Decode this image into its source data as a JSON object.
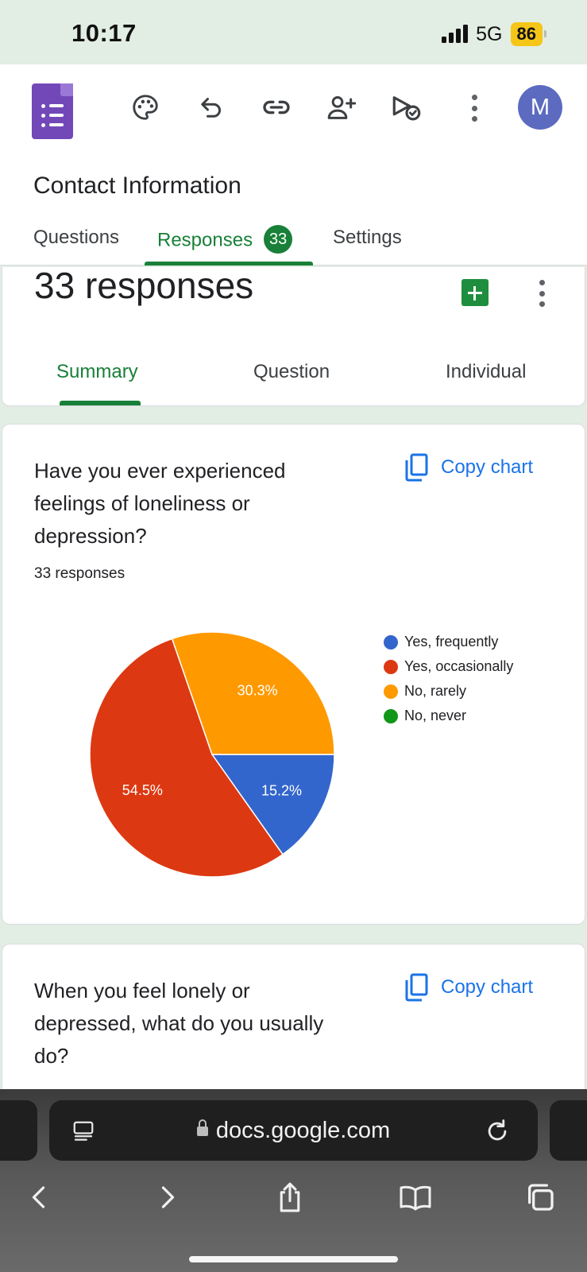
{
  "status_bar": {
    "time": "10:17",
    "network": "5G",
    "battery": "86"
  },
  "form": {
    "title": "Contact Information",
    "avatar_initial": "M",
    "tabs": {
      "questions": "Questions",
      "responses": "Responses",
      "responses_count": "33",
      "settings": "Settings"
    }
  },
  "summary": {
    "response_count": "33 responses",
    "sub_tabs": {
      "summary": "Summary",
      "question": "Question",
      "individual": "Individual"
    }
  },
  "questions": [
    {
      "title": "Have you ever experienced feelings of loneliness or depression?",
      "responses": "33 responses",
      "copy_label": "Copy chart"
    },
    {
      "title": "When you feel lonely or depressed, what do you usually do?",
      "copy_label": "Copy chart"
    }
  ],
  "chart_data": {
    "type": "pie",
    "title": "Have you ever experienced feelings of loneliness or depression?",
    "categories": [
      "Yes, frequently",
      "Yes, occasionally",
      "No, rarely",
      "No, never"
    ],
    "values": [
      15.2,
      54.5,
      30.3,
      0
    ],
    "labels": [
      "15.2%",
      "54.5%",
      "30.3%",
      ""
    ],
    "colors": [
      "#3366cc",
      "#dc3912",
      "#ff9900",
      "#109618"
    ],
    "legend_position": "right"
  },
  "browser": {
    "url": "docs.google.com"
  },
  "icons": {
    "toolbar": [
      "palette-icon",
      "undo-icon",
      "link-icon",
      "add-collaborator-icon",
      "preview-icon",
      "more-vert-icon"
    ],
    "nav": [
      "back-icon",
      "forward-icon",
      "share-icon",
      "bookmarks-icon",
      "tabs-icon"
    ]
  }
}
